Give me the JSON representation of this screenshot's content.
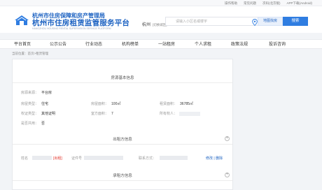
{
  "topbar": {
    "links": [
      "操作帮助",
      "常见问题",
      "次码(北京版)",
      "APP下载(Android)"
    ]
  },
  "header": {
    "org_line1": "杭州市住房保障和房产管理局",
    "org_line2": "杭州市住房租赁监管服务平台",
    "org_line3": "HANGZHOU HOUSING RENTAL SUPERVISION SERVICE PLATFORM",
    "city": "杭州",
    "city_switch": "[切换城区]",
    "search_placeholder": "请输入小区名或楼宇",
    "map_button": "地图找房",
    "search_button": "搜索"
  },
  "nav": {
    "items": [
      "平台首页",
      "公示公告",
      "行业动态",
      "机构榜单",
      "一站租房",
      "个人求租",
      "政策法规",
      "投诉咨询"
    ]
  },
  "breadcrumb": "当前位置：首页>租赁管理",
  "sections": {
    "house_info_title": "房源基本信息",
    "lessor_title": "出租方信息",
    "lessee_title": "承租方信息"
  },
  "house_fields": {
    "house_source_label": "房源来源：",
    "house_source_value": "平台房",
    "house_type_label": "房屋类型：",
    "house_type_value": "住宅",
    "building_area_label": "房屋面积：",
    "building_area_value": "100㎡",
    "rent_area_label": "租赁面积：",
    "rent_area_value": "36785㎡",
    "owner_type_label": "权证类型：",
    "owner_type_value": "其他证明",
    "room_count_label": "室方面积：",
    "room_count_value": "7",
    "owner_label": "所有权人：",
    "owner_value": "",
    "shared_label": "是否共用：",
    "shared_value": "否"
  },
  "lessor": {
    "name_label": "姓名",
    "tag": "[出租]",
    "phone_label": "证件号",
    "contact_label": "联系方式：",
    "edit": "修改",
    "delete": "删除"
  },
  "icons": {
    "logo": "house-logo-icon",
    "location": "location-pin-icon",
    "plus": "plus-circle-icon"
  },
  "colors": {
    "brand": "#1e63c2",
    "search_button": "#2f7de1",
    "tag_red": "#e2332a"
  }
}
